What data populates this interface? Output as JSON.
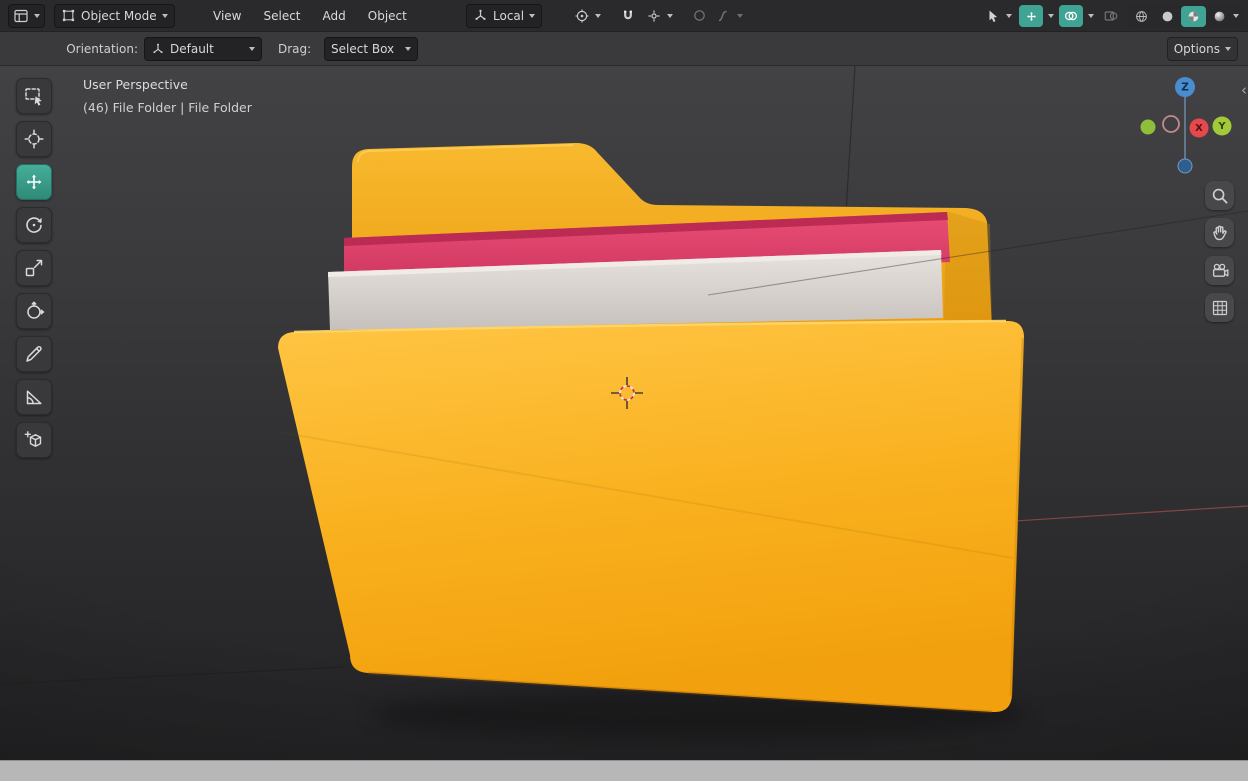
{
  "header": {
    "mode_label": "Object Mode",
    "menus": [
      "View",
      "Select",
      "Add",
      "Object"
    ],
    "transform_orientation": "Local"
  },
  "tool_settings": {
    "orientation_label": "Orientation:",
    "orientation_value": "Default",
    "drag_label": "Drag:",
    "drag_value": "Select Box",
    "options_label": "Options"
  },
  "viewport": {
    "view_label": "User Perspective",
    "selection_info": "(46) File Folder | File Folder",
    "axis_gizmo": {
      "x": "X",
      "y": "Y",
      "z": "Z"
    }
  },
  "toolbar": {
    "active_tool": "move-tool",
    "tools": [
      "select-box-tool",
      "cursor-tool",
      "move-tool",
      "rotate-tool",
      "scale-tool",
      "transform-tool",
      "annotate-tool",
      "measure-tool",
      "add-cube-tool"
    ]
  },
  "nav_controls": [
    "zoom-icon",
    "pan-hand-icon",
    "camera-view-icon",
    "orthographic-grid-icon"
  ],
  "icons": {
    "header": [
      "editor-type-icon",
      "object-mode-icon",
      "transform-orientation-icon",
      "pivot-point-icon",
      "snap-magnet-icon",
      "snap-increment-icon",
      "proportional-editing-icon",
      "falloff-curve-icon",
      "pointer-dropdown-icon",
      "show-gizmo-icon",
      "show-overlays-icon",
      "xray-icon",
      "wireframe-shading-icon",
      "solid-shading-icon",
      "material-preview-icon",
      "rendered-shading-icon"
    ]
  },
  "colors": {
    "accent_teal": "#3FA493",
    "folder_yellow": "#F9AE1E",
    "paper_pink": "#E4476F",
    "paper_white": "#DCD7D2",
    "axis_x_red": "#E5484D",
    "axis_y_green": "#9EC93B",
    "axis_z_blue": "#4A8CD0"
  }
}
